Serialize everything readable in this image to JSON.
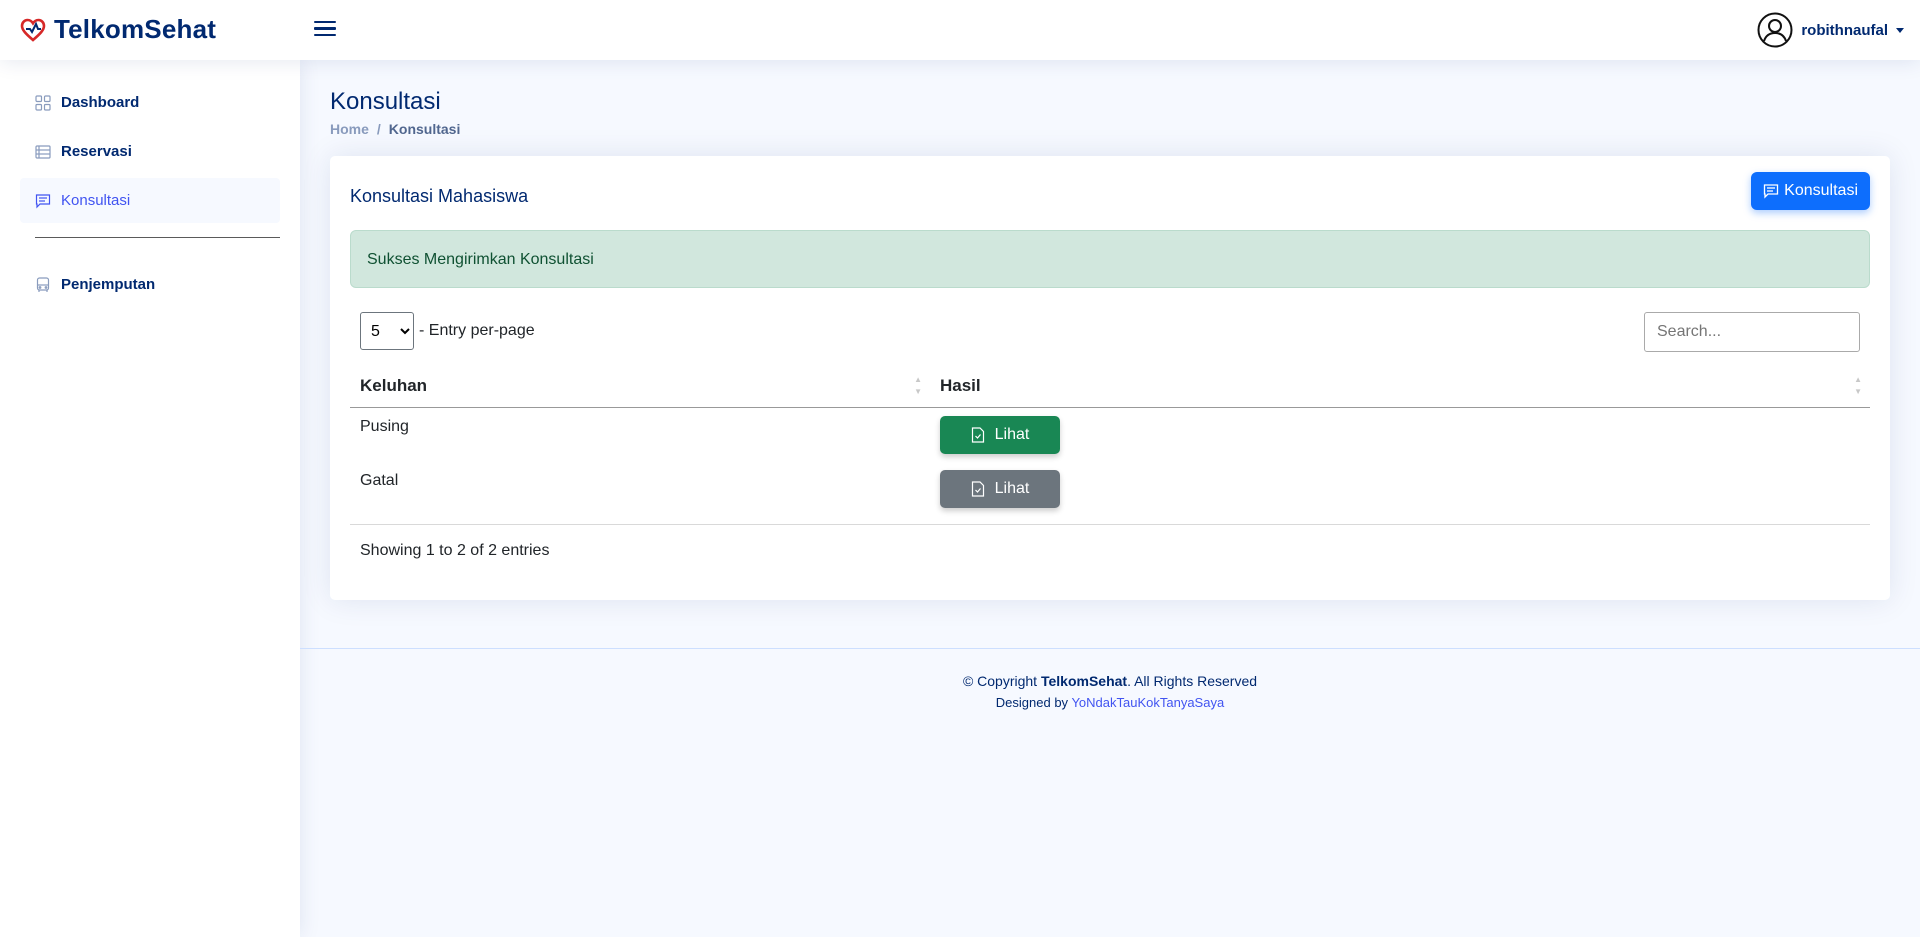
{
  "app": {
    "name": "TelkomSehat",
    "logo_icon": "heart-pulse-icon"
  },
  "header": {
    "menu_icon": "hamburger-icon",
    "user": "robithnaufal",
    "user_icon": "person-circle-icon"
  },
  "sidebar": {
    "items": [
      {
        "label": "Dashboard",
        "icon": "grid-icon"
      },
      {
        "label": "Reservasi",
        "icon": "list-icon"
      },
      {
        "label": "Konsultasi",
        "icon": "chat-icon",
        "active": true
      }
    ],
    "secondary": [
      {
        "label": "Penjemputan",
        "icon": "bus-icon"
      }
    ]
  },
  "page": {
    "title": "Konsultasi",
    "breadcrumb": {
      "home": "Home",
      "separator": "/",
      "current": "Konsultasi"
    }
  },
  "card": {
    "title": "Konsultasi Mahasiswa",
    "button_label": "Konsultasi",
    "alert": "Sukses Mengirimkan Konsultasi",
    "entries": {
      "selected": "5",
      "label": "- Entry per-page"
    },
    "search": {
      "placeholder": "Search...",
      "value": ""
    },
    "table": {
      "columns": [
        "Keluhan",
        "Hasil"
      ],
      "rows": [
        {
          "keluhan": "Pusing",
          "action": "Lihat",
          "status_color": "#198754"
        },
        {
          "keluhan": "Gatal",
          "action": "Lihat",
          "status_color": "#6c757d"
        }
      ]
    },
    "info": "Showing 1 to 2 of 2 entries"
  },
  "footer": {
    "copyright_prefix": "© Copyright",
    "brand": "TelkomSehat",
    "rights": ". All Rights Reserved",
    "designed_by_label": "Designed by",
    "designer": "YoNdakTauKokTanyaSaya"
  },
  "colors": {
    "primary": "#012970",
    "accent": "#4154f1",
    "button_primary": "#0d6efd"
  }
}
